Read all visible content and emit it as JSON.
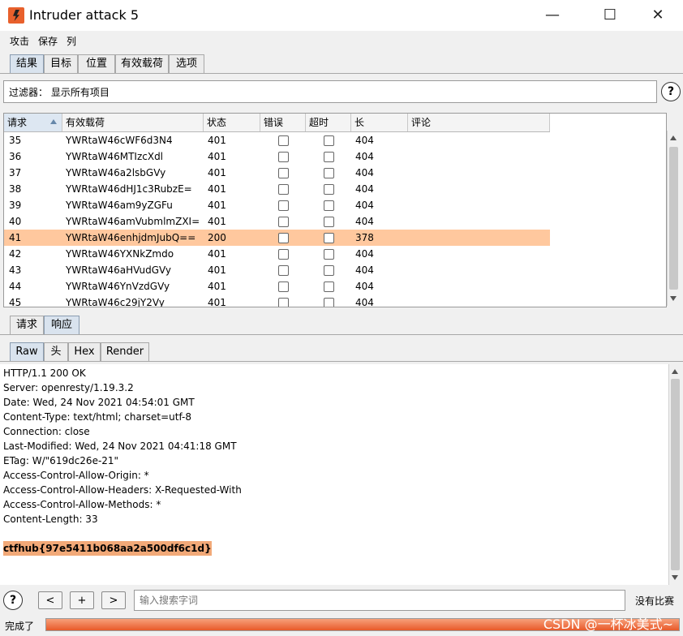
{
  "window": {
    "title": "Intruder attack 5",
    "minimize": "—",
    "maximize": "☐",
    "close": "✕"
  },
  "menu": [
    "攻击",
    "保存",
    "列"
  ],
  "top_tabs": [
    {
      "label": "结果",
      "active": true
    },
    {
      "label": "目标",
      "active": false
    },
    {
      "label": "位置",
      "active": false
    },
    {
      "label": "有效载荷",
      "active": false
    },
    {
      "label": "选项",
      "active": false
    }
  ],
  "filter": {
    "text": "过滤器： 显示所有项目",
    "help": "?"
  },
  "table": {
    "columns": [
      "请求",
      "有效载荷",
      "状态",
      "错误",
      "超时",
      "长",
      "评论"
    ],
    "rows": [
      {
        "req": "35",
        "payload": "YWRtaW46cWF6d3N4",
        "status": "401",
        "error": false,
        "timeout": false,
        "length": "404",
        "comment": "",
        "selected": false
      },
      {
        "req": "36",
        "payload": "YWRtaW46MTIzcXdl",
        "status": "401",
        "error": false,
        "timeout": false,
        "length": "404",
        "comment": "",
        "selected": false
      },
      {
        "req": "37",
        "payload": "YWRtaW46a2lsbGVy",
        "status": "401",
        "error": false,
        "timeout": false,
        "length": "404",
        "comment": "",
        "selected": false
      },
      {
        "req": "38",
        "payload": "YWRtaW46dHJ1c3RubzE=",
        "status": "401",
        "error": false,
        "timeout": false,
        "length": "404",
        "comment": "",
        "selected": false
      },
      {
        "req": "39",
        "payload": "YWRtaW46am9yZGFu",
        "status": "401",
        "error": false,
        "timeout": false,
        "length": "404",
        "comment": "",
        "selected": false
      },
      {
        "req": "40",
        "payload": "YWRtaW46amVubmlmZXI=",
        "status": "401",
        "error": false,
        "timeout": false,
        "length": "404",
        "comment": "",
        "selected": false
      },
      {
        "req": "41",
        "payload": "YWRtaW46enhjdmJubQ==",
        "status": "200",
        "error": false,
        "timeout": false,
        "length": "378",
        "comment": "",
        "selected": true
      },
      {
        "req": "42",
        "payload": "YWRtaW46YXNkZmdo",
        "status": "401",
        "error": false,
        "timeout": false,
        "length": "404",
        "comment": "",
        "selected": false
      },
      {
        "req": "43",
        "payload": "YWRtaW46aHVudGVy",
        "status": "401",
        "error": false,
        "timeout": false,
        "length": "404",
        "comment": "",
        "selected": false
      },
      {
        "req": "44",
        "payload": "YWRtaW46YnVzdGVy",
        "status": "401",
        "error": false,
        "timeout": false,
        "length": "404",
        "comment": "",
        "selected": false
      },
      {
        "req": "45",
        "payload": "YWRtaW46c29jY2Vy",
        "status": "401",
        "error": false,
        "timeout": false,
        "length": "404",
        "comment": "",
        "selected": false
      }
    ]
  },
  "detail_tabs": [
    {
      "label": "请求",
      "active": false
    },
    {
      "label": "响应",
      "active": true
    }
  ],
  "view_tabs": [
    {
      "label": "Raw",
      "active": true
    },
    {
      "label": "头",
      "active": false
    },
    {
      "label": "Hex",
      "active": false
    },
    {
      "label": "Render",
      "active": false
    }
  ],
  "response": {
    "lines": [
      "HTTP/1.1 200 OK",
      "Server: openresty/1.19.3.2",
      "Date: Wed, 24 Nov 2021 04:54:01 GMT",
      "Content-Type: text/html; charset=utf-8",
      "Connection: close",
      "Last-Modified: Wed, 24 Nov 2021 04:41:18 GMT",
      "ETag: W/\"619dc26e-21\"",
      "Access-Control-Allow-Origin: *",
      "Access-Control-Allow-Headers: X-Requested-With",
      "Access-Control-Allow-Methods: *",
      "Content-Length: 33"
    ],
    "flag": "ctfhub{97e5411b068aa2a500df6c1d}"
  },
  "search": {
    "help": "?",
    "prev": "<",
    "add": "+",
    "next": ">",
    "placeholder": "输入搜索字词",
    "result": "没有比赛"
  },
  "status": {
    "text": "完成了",
    "progress": 1.0,
    "watermark": "CSDN @一杯冰美式~"
  },
  "colors": {
    "selected_row": "#ffc89e",
    "flag_highlight": "#f2a978",
    "progress": "#e85a2a"
  }
}
